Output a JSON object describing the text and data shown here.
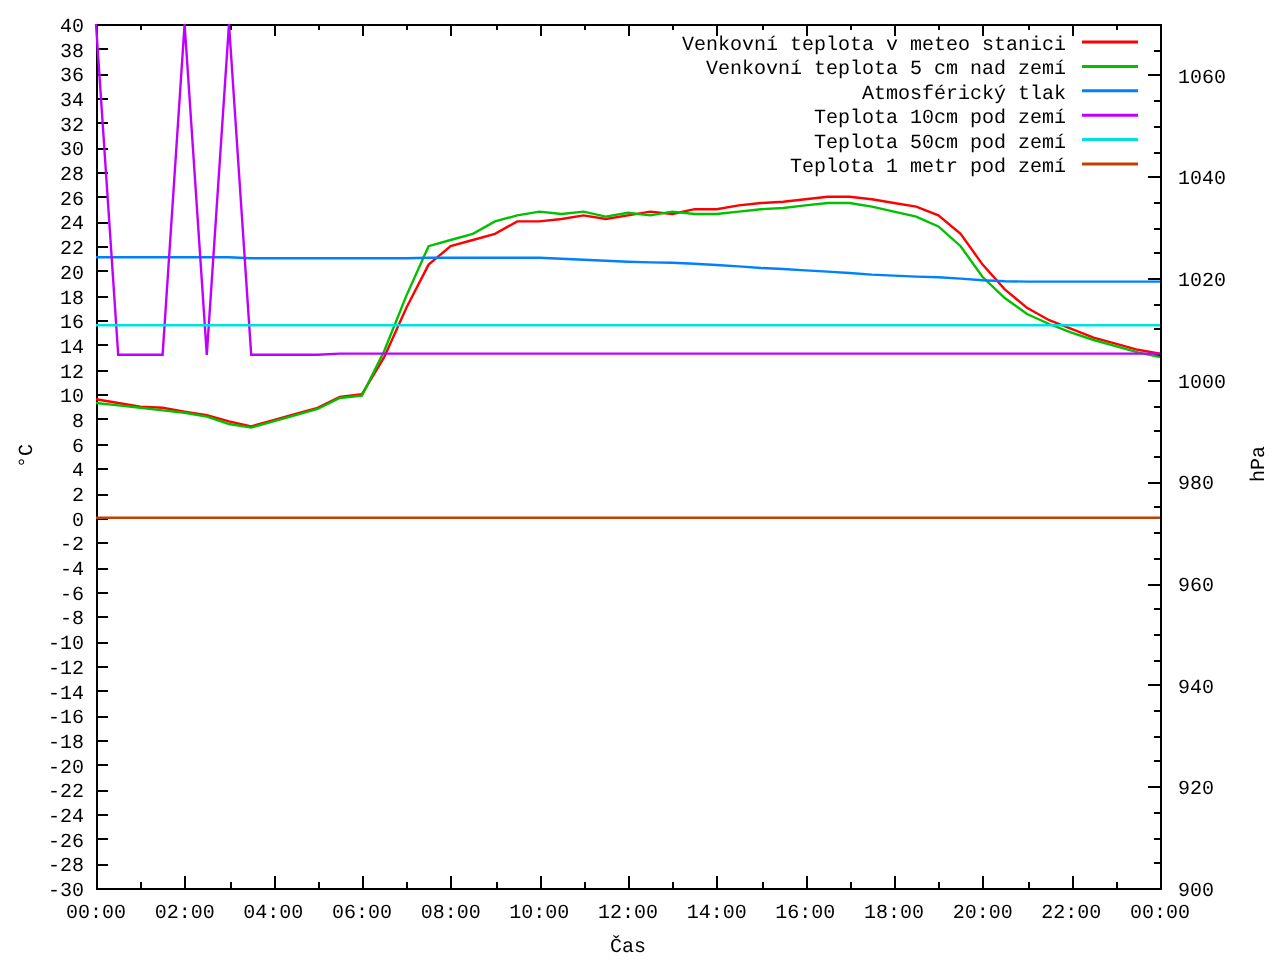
{
  "chart_data": {
    "type": "line",
    "legend": true,
    "xlabel": "Čas",
    "ylabel": "°C",
    "y2label": "hPa",
    "x": [
      0,
      0.5,
      1,
      1.5,
      2,
      2.5,
      3,
      3.5,
      4,
      4.5,
      5,
      5.5,
      6,
      6.5,
      7,
      7.5,
      8,
      8.5,
      9,
      9.5,
      10,
      10.5,
      11,
      11.5,
      12,
      12.5,
      13,
      13.5,
      14,
      14.5,
      15,
      15.5,
      16,
      16.5,
      17,
      17.5,
      18,
      18.5,
      19,
      19.5,
      20,
      20.5,
      21,
      21.5,
      22,
      22.5,
      23,
      23.5,
      24
    ],
    "xlim": [
      0,
      24
    ],
    "ylim": [
      -30,
      40
    ],
    "y2lim": [
      900,
      1070
    ],
    "xticks": [
      {
        "value": 0,
        "label": "00:00"
      },
      {
        "value": 2,
        "label": "02:00"
      },
      {
        "value": 4,
        "label": "04:00"
      },
      {
        "value": 6,
        "label": "06:00"
      },
      {
        "value": 8,
        "label": "08:00"
      },
      {
        "value": 10,
        "label": "10:00"
      },
      {
        "value": 12,
        "label": "12:00"
      },
      {
        "value": 14,
        "label": "14:00"
      },
      {
        "value": 16,
        "label": "16:00"
      },
      {
        "value": 18,
        "label": "18:00"
      },
      {
        "value": 20,
        "label": "20:00"
      },
      {
        "value": 22,
        "label": "22:00"
      },
      {
        "value": 24,
        "label": "00:00"
      }
    ],
    "yticks": [
      -30,
      -28,
      -26,
      -24,
      -22,
      -20,
      -18,
      -16,
      -14,
      -12,
      -10,
      -8,
      -6,
      -4,
      -2,
      0,
      2,
      4,
      6,
      8,
      10,
      12,
      14,
      16,
      18,
      20,
      22,
      24,
      26,
      28,
      30,
      32,
      34,
      36,
      38,
      40
    ],
    "y2ticks": [
      900,
      920,
      940,
      960,
      980,
      1000,
      1020,
      1040,
      1060
    ],
    "series": [
      {
        "name": "Venkovní teplota v meteo stanici",
        "color": "#ff0000",
        "axis": "y",
        "values": [
          9.6,
          9.3,
          9.0,
          8.9,
          8.6,
          8.3,
          7.8,
          7.4,
          7.9,
          8.4,
          8.9,
          9.8,
          10.0,
          13.0,
          17.0,
          20.5,
          22.0,
          22.5,
          23.0,
          24.0,
          24.0,
          24.2,
          24.5,
          24.2,
          24.5,
          24.8,
          24.6,
          25.0,
          25.0,
          25.3,
          25.5,
          25.6,
          25.8,
          26.0,
          26.0,
          25.8,
          25.5,
          25.2,
          24.5,
          23.0,
          20.5,
          18.5,
          17.0,
          16.0,
          15.3,
          14.6,
          14.1,
          13.6,
          13.3
        ]
      },
      {
        "name": "Venkovní teplota 5 cm nad zemí",
        "color": "#00c000",
        "axis": "y",
        "values": [
          9.3,
          9.1,
          8.9,
          8.7,
          8.5,
          8.2,
          7.6,
          7.3,
          7.8,
          8.3,
          8.8,
          9.7,
          9.9,
          13.5,
          18.0,
          22.0,
          22.5,
          23.0,
          24.0,
          24.5,
          24.8,
          24.6,
          24.8,
          24.4,
          24.7,
          24.5,
          24.8,
          24.6,
          24.6,
          24.8,
          25.0,
          25.1,
          25.3,
          25.5,
          25.5,
          25.2,
          24.8,
          24.4,
          23.6,
          22.0,
          19.5,
          17.8,
          16.5,
          15.7,
          15.0,
          14.4,
          13.9,
          13.4,
          13.0
        ]
      },
      {
        "name": "Atmosférický tlak",
        "color": "#0080ff",
        "axis": "y2",
        "values": [
          1024.1,
          1024.1,
          1024.1,
          1024.1,
          1024.1,
          1024.1,
          1024.1,
          1023.9,
          1023.9,
          1023.9,
          1023.9,
          1023.9,
          1023.9,
          1023.9,
          1023.9,
          1024.0,
          1024.0,
          1024.0,
          1024.0,
          1024.0,
          1024.0,
          1023.8,
          1023.6,
          1023.4,
          1023.2,
          1023.1,
          1023.0,
          1022.8,
          1022.6,
          1022.3,
          1022.0,
          1021.8,
          1021.5,
          1021.3,
          1021.0,
          1020.7,
          1020.5,
          1020.3,
          1020.2,
          1019.9,
          1019.6,
          1019.4,
          1019.3,
          1019.3,
          1019.3,
          1019.3,
          1019.3,
          1019.3,
          1019.3
        ]
      },
      {
        "name": "Teplota 10cm pod zemí",
        "color": "#c000ff",
        "axis": "y",
        "values": [
          40,
          13.2,
          13.2,
          13.2,
          40,
          13.2,
          40,
          13.2,
          13.2,
          13.2,
          13.2,
          13.3,
          13.3,
          13.3,
          13.3,
          13.3,
          13.3,
          13.3,
          13.3,
          13.3,
          13.3,
          13.3,
          13.3,
          13.3,
          13.3,
          13.3,
          13.3,
          13.3,
          13.3,
          13.3,
          13.3,
          13.3,
          13.3,
          13.3,
          13.3,
          13.3,
          13.3,
          13.3,
          13.3,
          13.3,
          13.3,
          13.3,
          13.3,
          13.3,
          13.3,
          13.3,
          13.3,
          13.3,
          13.3
        ]
      },
      {
        "name": "Teplota 50cm pod zemí",
        "color": "#00e0e0",
        "axis": "y",
        "values": [
          15.6,
          15.6,
          15.6,
          15.6,
          15.6,
          15.6,
          15.6,
          15.6,
          15.6,
          15.6,
          15.6,
          15.6,
          15.6,
          15.6,
          15.6,
          15.6,
          15.6,
          15.6,
          15.6,
          15.6,
          15.6,
          15.6,
          15.6,
          15.6,
          15.6,
          15.6,
          15.6,
          15.6,
          15.6,
          15.6,
          15.6,
          15.6,
          15.6,
          15.6,
          15.6,
          15.6,
          15.6,
          15.6,
          15.6,
          15.6,
          15.6,
          15.6,
          15.6,
          15.6,
          15.6,
          15.6,
          15.6,
          15.6,
          15.6
        ]
      },
      {
        "name": "Teplota 1 metr pod zemí",
        "color": "#c04000",
        "axis": "y",
        "values": [
          0,
          0,
          0,
          0,
          0,
          0,
          0,
          0,
          0,
          0,
          0,
          0,
          0,
          0,
          0,
          0,
          0,
          0,
          0,
          0,
          0,
          0,
          0,
          0,
          0,
          0,
          0,
          0,
          0,
          0,
          0,
          0,
          0,
          0,
          0,
          0,
          0,
          0,
          0,
          0,
          0,
          0,
          0,
          0,
          0,
          0,
          0,
          0,
          0
        ]
      }
    ]
  }
}
